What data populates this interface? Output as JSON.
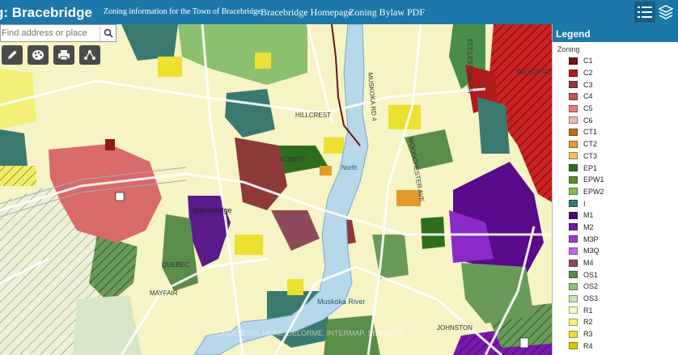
{
  "header": {
    "title": "g: Bracebridge",
    "subtitle": "Zoning information for the Town of Bracebridge",
    "links": [
      "Bracebridge Homepage",
      "Zoning Bylaw PDF"
    ],
    "icons": [
      "legend-list-icon",
      "layers-icon"
    ]
  },
  "search": {
    "placeholder": "Find address or place"
  },
  "tools": [
    "pencil-icon",
    "palette-icon",
    "printer-icon",
    "share-icon"
  ],
  "map": {
    "labels": [
      "Bracebridge",
      "Muskoka River",
      "North",
      "HILLCREST",
      "ROBERT",
      "ECCLESTONE DR",
      "TAYLOR RD",
      "MUSKOKA RD 4",
      "WOODCHESTER AVE",
      "JOHNSTON",
      "MAYFAIR",
      "QUEBEC"
    ],
    "watermark": "SOURCE: ESRI, HERE, DELORME, INTERMAP, SERVICES"
  },
  "legend": {
    "title": "Legend",
    "group": "Zoning",
    "items": [
      {
        "code": "C1",
        "color": "#6e1414"
      },
      {
        "code": "C2",
        "color": "#b01c1c"
      },
      {
        "code": "C3",
        "color": "#8c3a3a"
      },
      {
        "code": "C4",
        "color": "#b85a5a"
      },
      {
        "code": "C5",
        "color": "#e07c7c"
      },
      {
        "code": "C6",
        "color": "#f1b3b3"
      },
      {
        "code": "CT1",
        "color": "#b8701c"
      },
      {
        "code": "CT2",
        "color": "#e09a2e"
      },
      {
        "code": "CT3",
        "color": "#f3bf5a"
      },
      {
        "code": "EP1",
        "color": "#2e6e1a"
      },
      {
        "code": "EPW1",
        "color": "#5a8c2e"
      },
      {
        "code": "EPW2",
        "color": "#8cb84a"
      },
      {
        "code": "I",
        "color": "#3a7a6e"
      },
      {
        "code": "M1",
        "color": "#4a0a7a"
      },
      {
        "code": "M2",
        "color": "#6e1a9a"
      },
      {
        "code": "M3P",
        "color": "#9a3ac8"
      },
      {
        "code": "M3Q",
        "color": "#c06ae0"
      },
      {
        "code": "M4",
        "color": "#8c4a5a"
      },
      {
        "code": "OS1",
        "color": "#5a8c4a"
      },
      {
        "code": "OS2",
        "color": "#8cc06e"
      },
      {
        "code": "OS3",
        "color": "#c6e0b0"
      },
      {
        "code": "R1",
        "color": "#fafac8"
      },
      {
        "code": "R2",
        "color": "#f3f07a"
      },
      {
        "code": "R3",
        "color": "#ece030"
      },
      {
        "code": "R4",
        "color": "#d8c800"
      }
    ]
  }
}
